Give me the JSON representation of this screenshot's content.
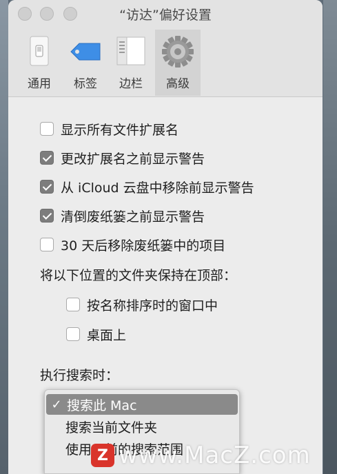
{
  "window": {
    "title": "“访达”偏好设置"
  },
  "toolbar": {
    "items": [
      {
        "label": "通用",
        "icon": "general-switch-icon"
      },
      {
        "label": "标签",
        "icon": "tag-icon"
      },
      {
        "label": "边栏",
        "icon": "sidebar-icon"
      },
      {
        "label": "高级",
        "icon": "gear-icon",
        "selected": true
      }
    ]
  },
  "options": [
    {
      "label": "显示所有文件扩展名",
      "checked": false
    },
    {
      "label": "更改扩展名之前显示警告",
      "checked": true
    },
    {
      "label": "从 iCloud 云盘中移除前显示警告",
      "checked": true
    },
    {
      "label": "清倒废纸篓之前显示警告",
      "checked": true
    },
    {
      "label": "30 天后移除废纸篓中的项目",
      "checked": false
    }
  ],
  "folders_on_top": {
    "label": "将以下位置的文件夹保持在顶部：",
    "options": [
      {
        "label": "按名称排序时的窗口中",
        "checked": false
      },
      {
        "label": "桌面上",
        "checked": false
      }
    ]
  },
  "search": {
    "label": "执行搜索时：",
    "menu": [
      {
        "label": "搜索此 Mac",
        "selected": true,
        "check": "✓"
      },
      {
        "label": "搜索当前文件夹",
        "selected": false
      },
      {
        "label": "使用以前的搜索范围",
        "selected": false
      }
    ]
  },
  "watermark": {
    "logo": "Z",
    "text": "www.MacZ.com"
  },
  "colors": {
    "accent": "#7d7d7d",
    "window_bg": "#ececec",
    "watermark_logo": "#d9342b"
  }
}
